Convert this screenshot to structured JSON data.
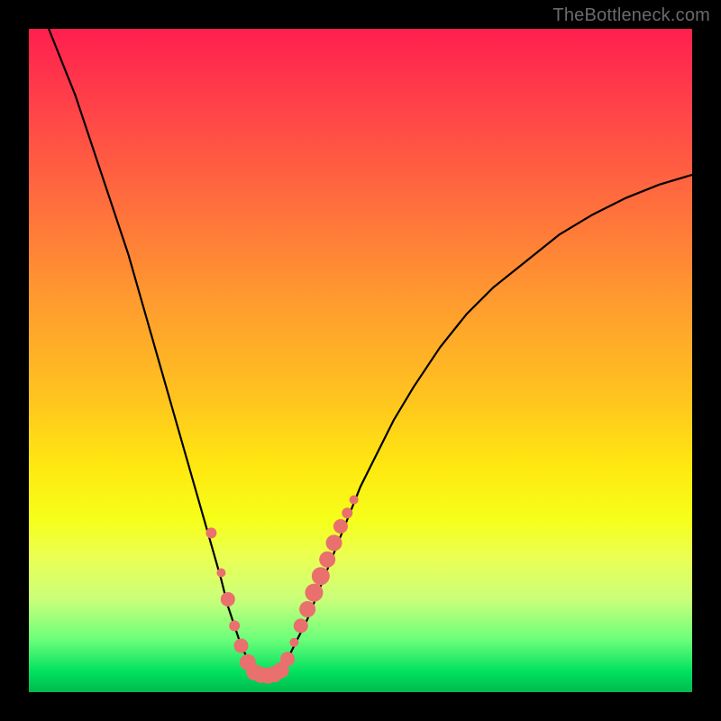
{
  "watermark": "TheBottleneck.com",
  "chart_data": {
    "type": "line",
    "title": "",
    "xlabel": "",
    "ylabel": "",
    "xlim": [
      0,
      100
    ],
    "ylim": [
      0,
      100
    ],
    "series": [
      {
        "name": "curve-left",
        "x": [
          3,
          5,
          7,
          9,
          11,
          13,
          15,
          17,
          19,
          21,
          23,
          25,
          27,
          29,
          30,
          31,
          32,
          33,
          34,
          35,
          36
        ],
        "y": [
          100,
          95,
          90,
          84,
          78,
          72,
          66,
          59,
          52,
          45,
          38,
          31,
          24,
          17,
          13,
          10,
          7,
          5,
          3.5,
          2.8,
          2.5
        ]
      },
      {
        "name": "curve-right",
        "x": [
          36,
          37,
          38,
          39,
          40,
          42,
          44,
          46,
          48,
          50,
          52,
          55,
          58,
          62,
          66,
          70,
          75,
          80,
          85,
          90,
          95,
          100
        ],
        "y": [
          2.5,
          2.8,
          3.5,
          5,
          7,
          11,
          16,
          21,
          26,
          31,
          35,
          41,
          46,
          52,
          57,
          61,
          65,
          69,
          72,
          74.5,
          76.5,
          78
        ]
      }
    ],
    "beads": {
      "name": "beads",
      "color": "#e9706c",
      "points": [
        {
          "x": 27.5,
          "y": 24,
          "r": 6
        },
        {
          "x": 29,
          "y": 18,
          "r": 5
        },
        {
          "x": 30,
          "y": 14,
          "r": 8
        },
        {
          "x": 31,
          "y": 10,
          "r": 6
        },
        {
          "x": 32,
          "y": 7,
          "r": 8
        },
        {
          "x": 33,
          "y": 4.5,
          "r": 9
        },
        {
          "x": 34,
          "y": 3,
          "r": 9
        },
        {
          "x": 35,
          "y": 2.6,
          "r": 9
        },
        {
          "x": 36,
          "y": 2.5,
          "r": 9
        },
        {
          "x": 37,
          "y": 2.7,
          "r": 9
        },
        {
          "x": 38,
          "y": 3.3,
          "r": 9
        },
        {
          "x": 39,
          "y": 5,
          "r": 8
        },
        {
          "x": 40,
          "y": 7.5,
          "r": 5
        },
        {
          "x": 41,
          "y": 10,
          "r": 8
        },
        {
          "x": 42,
          "y": 12.5,
          "r": 9
        },
        {
          "x": 43,
          "y": 15,
          "r": 10
        },
        {
          "x": 44,
          "y": 17.5,
          "r": 10
        },
        {
          "x": 45,
          "y": 20,
          "r": 9
        },
        {
          "x": 46,
          "y": 22.5,
          "r": 9
        },
        {
          "x": 47,
          "y": 25,
          "r": 8
        },
        {
          "x": 48,
          "y": 27,
          "r": 6
        },
        {
          "x": 49,
          "y": 29,
          "r": 5
        }
      ]
    }
  }
}
